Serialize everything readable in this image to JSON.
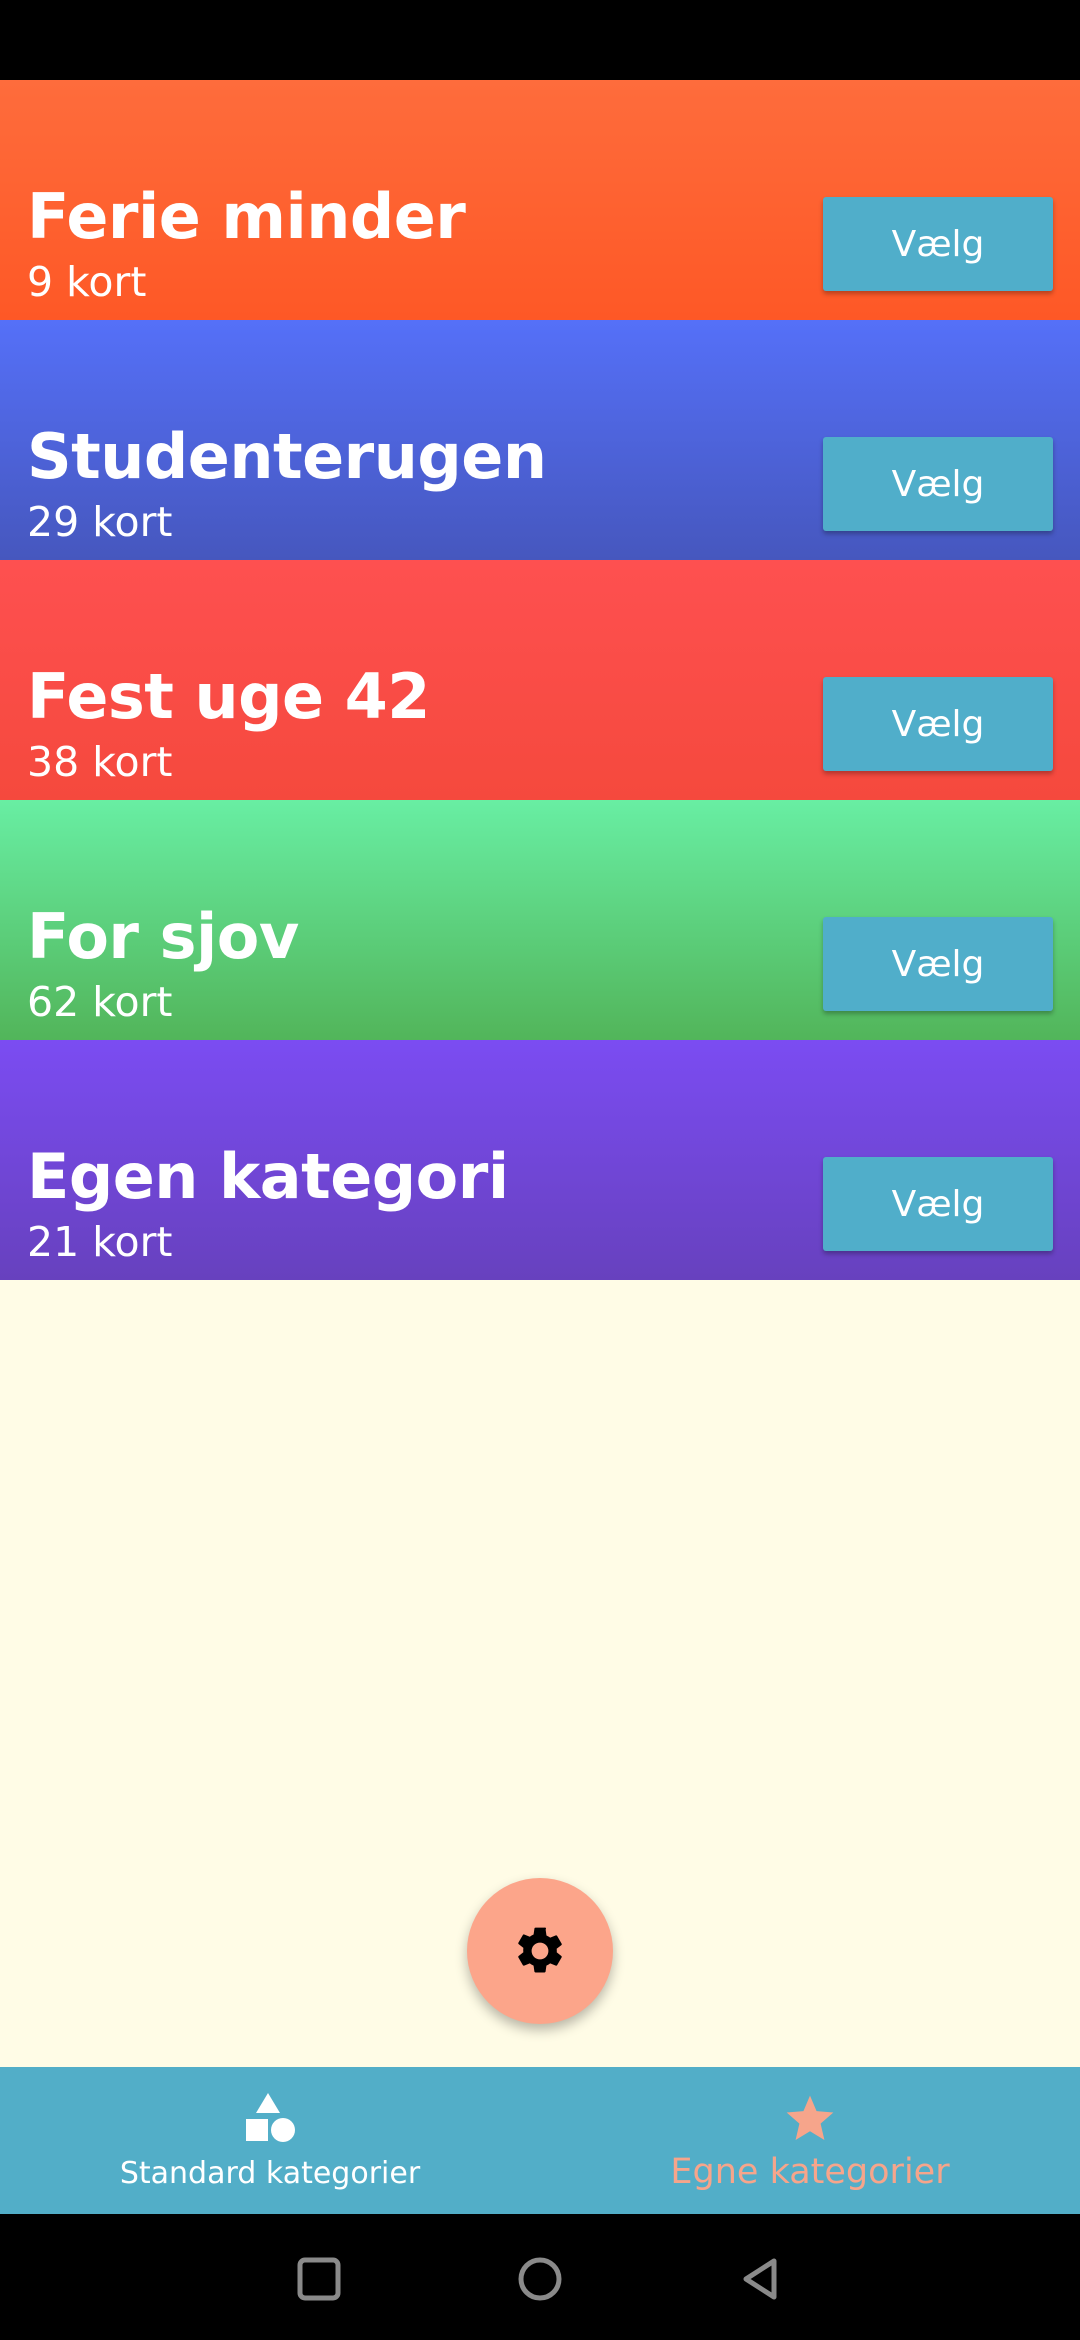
{
  "categories": [
    {
      "title": "Ferie minder",
      "count": "9 kort",
      "button": "Vælg",
      "gradient": [
        "#FE6C3C",
        "#FE5826"
      ]
    },
    {
      "title": "Studenterugen",
      "count": "29 kort",
      "button": "Vælg",
      "gradient": [
        "#5570F8",
        "#4657BE"
      ]
    },
    {
      "title": "Fest uge 42",
      "count": "38 kort",
      "button": "Vælg",
      "gradient": [
        "#FE5050",
        "#F5493D"
      ]
    },
    {
      "title": "For sjov",
      "count": "62 kort",
      "button": "Vælg",
      "gradient": [
        "#68EEA3",
        "#52B55A"
      ]
    },
    {
      "title": "Egen kategori",
      "count": "21 kort",
      "button": "Vælg",
      "gradient": [
        "#7B4CF2",
        "#6741BE"
      ]
    }
  ],
  "fab": {
    "icon": "gear-icon",
    "color": "#FCA58A"
  },
  "bottom_nav": {
    "standard": {
      "label": "Standard kategorier",
      "icon": "shapes-icon"
    },
    "custom": {
      "label": "Egne kategorier",
      "icon": "star-icon",
      "active": true
    }
  },
  "colors": {
    "background": "#FFFCE6",
    "button": "#50AECA",
    "nav": "#52AEC8",
    "accent": "#F6A58B"
  }
}
